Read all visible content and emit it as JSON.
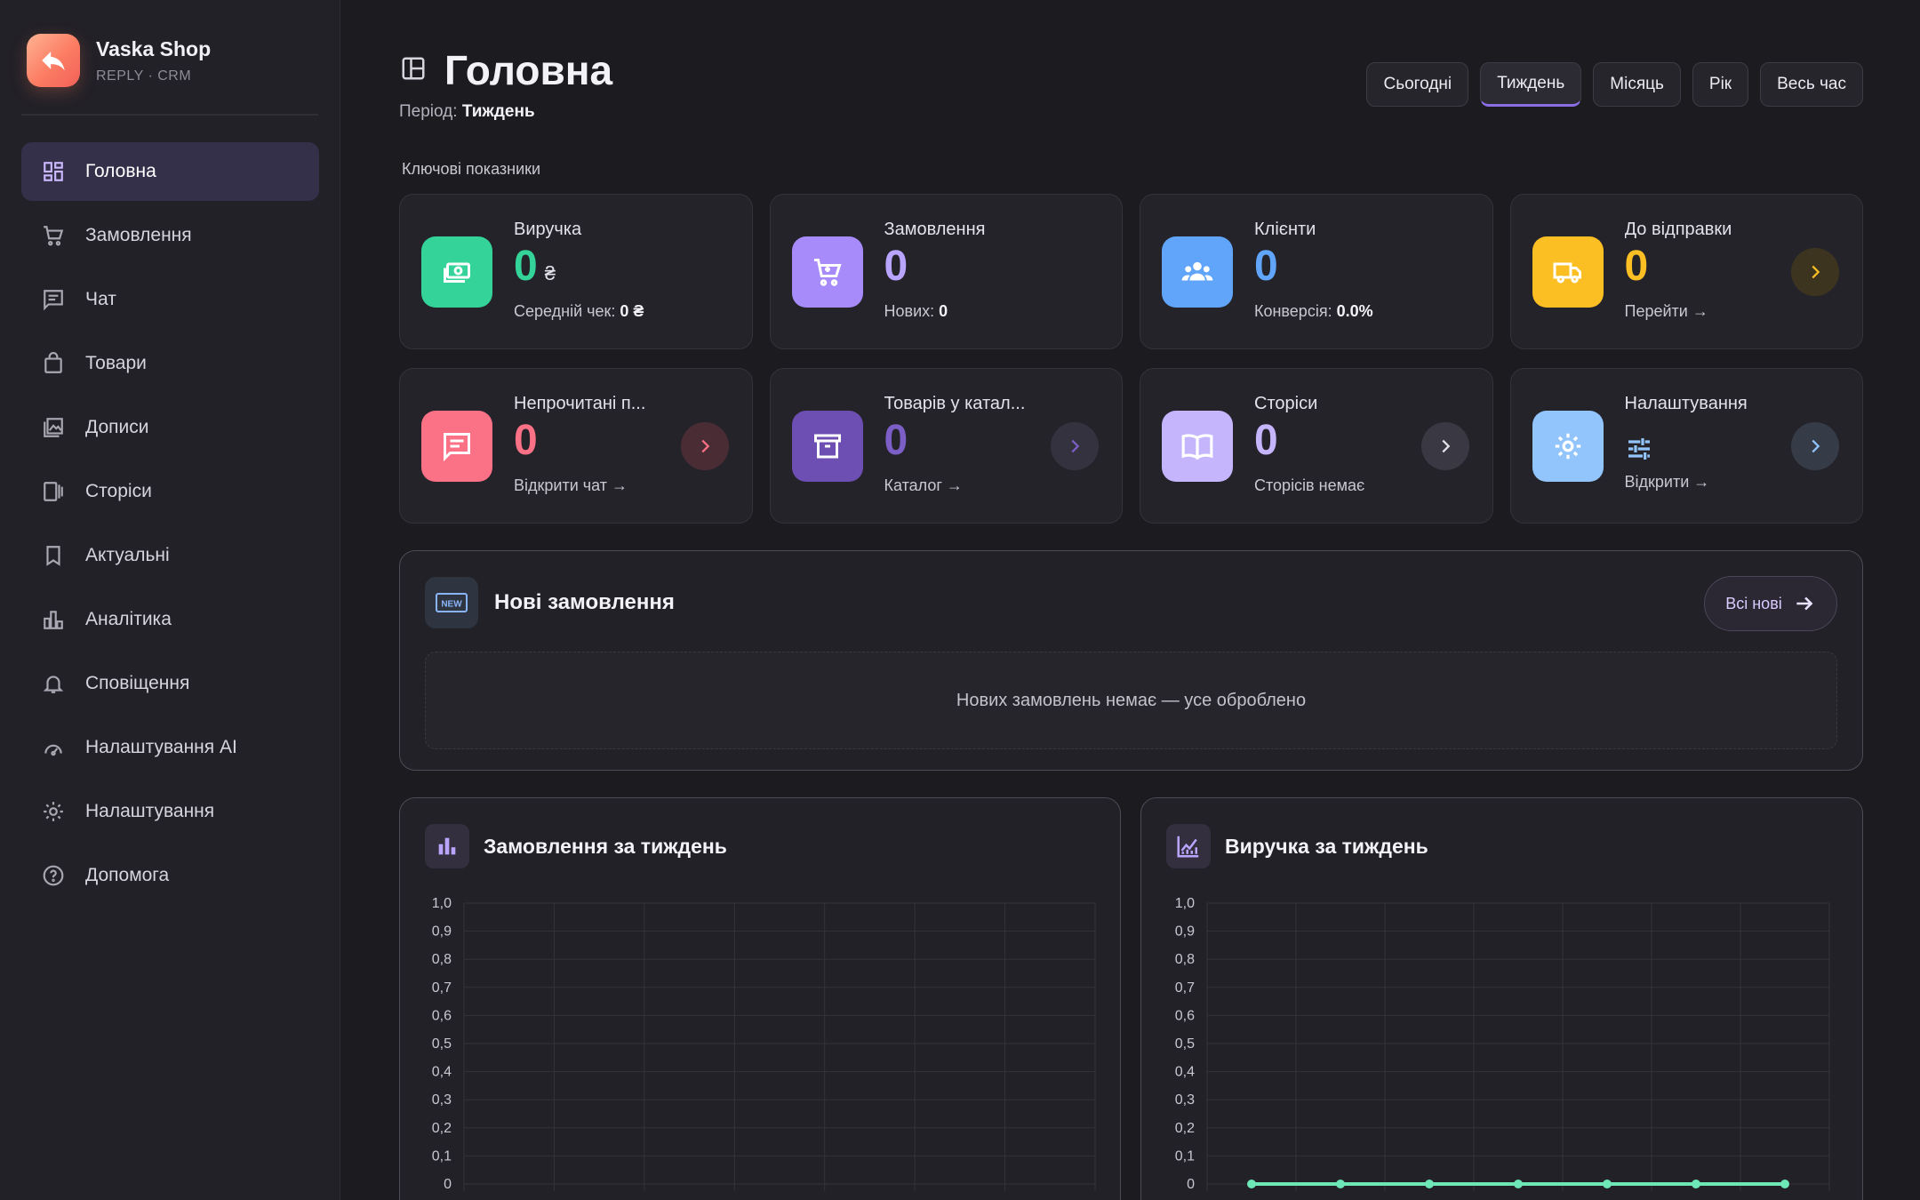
{
  "brand": {
    "name": "Vaska Shop",
    "subtitle": "REPLY · CRM",
    "accent": "#fb7c62"
  },
  "sidebar": {
    "items": [
      {
        "label": "Головна",
        "icon": "dashboard-icon",
        "active": true
      },
      {
        "label": "Замовлення",
        "icon": "cart-icon"
      },
      {
        "label": "Чат",
        "icon": "chat-icon"
      },
      {
        "label": "Товари",
        "icon": "shopping-bag-icon"
      },
      {
        "label": "Дописи",
        "icon": "photo-library-icon"
      },
      {
        "label": "Сторіси",
        "icon": "stories-icon"
      },
      {
        "label": "Актуальні",
        "icon": "bookmark-icon"
      },
      {
        "label": "Аналітика",
        "icon": "analytics-icon"
      },
      {
        "label": "Сповіщення",
        "icon": "bell-icon"
      },
      {
        "label": "Налаштування AI",
        "icon": "ai-settings-icon"
      },
      {
        "label": "Налаштування",
        "icon": "gear-icon"
      },
      {
        "label": "Допомога",
        "icon": "help-icon"
      }
    ]
  },
  "header": {
    "title": "Головна",
    "period_label": "Період:",
    "period_value": "Тиждень",
    "ranges": [
      {
        "label": "Сьогодні"
      },
      {
        "label": "Тиждень",
        "active": true
      },
      {
        "label": "Місяць"
      },
      {
        "label": "Рік"
      },
      {
        "label": "Весь час"
      }
    ]
  },
  "kpi_section_label": "Ключові показники",
  "kpis": [
    {
      "label": "Виручка",
      "value": "0",
      "unit": "₴",
      "sub_label": "Середній чек:",
      "sub_value": "0 ₴",
      "icon": "money-icon",
      "color": "#34d399",
      "value_color": "#34d399"
    },
    {
      "label": "Замовлення",
      "value": "0",
      "sub_label": "Нових:",
      "sub_value": "0",
      "icon": "cart-icon",
      "color": "#a78bfa",
      "value_color": "#b9a4ff"
    },
    {
      "label": "Клієнти",
      "value": "0",
      "sub_label": "Конверсія:",
      "sub_value": "0.0%",
      "icon": "people-icon",
      "color": "#60a5fa",
      "value_color": "#60a5fa"
    },
    {
      "label": "До відправки",
      "value": "0",
      "sub_label": "Перейти →",
      "icon": "truck-icon",
      "color": "#fbbf24",
      "value_color": "#fbbf24",
      "arrow": true
    },
    {
      "label": "Непрочитані п...",
      "value": "0",
      "sub_label": "Відкрити чат →",
      "icon": "chat-icon",
      "color": "#fb7185",
      "value_color": "#fb7185",
      "arrow": true
    },
    {
      "label": "Товарів у катал...",
      "value": "0",
      "sub_label": "Каталог →",
      "icon": "archive-icon",
      "color": "#6d4fb3",
      "value_color": "#7c5fc6",
      "arrow": true
    },
    {
      "label": "Сторіси",
      "value": "0",
      "sub_label": "Сторісів немає",
      "icon": "book-icon",
      "color": "#c4b5fd",
      "value_color": "#c4b5fd",
      "arrow": true
    },
    {
      "label": "Налаштування",
      "value": "",
      "sub_label": "Відкрити →",
      "icon": "gear-icon",
      "color": "#93c5fd",
      "value_color": "#93c5fd",
      "arrow": true,
      "value_icon": "sliders-icon"
    }
  ],
  "new_orders": {
    "badge": "NEW",
    "title": "Нові замовлення",
    "button": "Всі нові",
    "empty_text": "Нових замовлень немає — усе оброблено"
  },
  "charts": {
    "orders": {
      "title": "Замовлення за тиждень",
      "icon": "bar-chart-icon"
    },
    "revenue": {
      "title": "Виручка за тиждень",
      "icon": "line-chart-icon"
    }
  },
  "chart_data": [
    {
      "type": "bar",
      "title": "Замовлення за тиждень",
      "categories": [
        "",
        "",
        "",
        "",
        "",
        "",
        ""
      ],
      "values": [
        0,
        0,
        0,
        0,
        0,
        0,
        0
      ],
      "ylim": [
        0,
        1.0
      ],
      "yticks": [
        "1,0",
        "0,9",
        "0,8",
        "0,7",
        "0,6",
        "0,5",
        "0,4",
        "0,3",
        "0,2",
        "0,1",
        "0"
      ],
      "grid": true
    },
    {
      "type": "line",
      "title": "Виручка за тиждень",
      "categories": [
        "",
        "",
        "",
        "",
        "",
        "",
        ""
      ],
      "values": [
        0,
        0,
        0,
        0,
        0,
        0,
        0
      ],
      "ylim": [
        0,
        1.0
      ],
      "yticks": [
        "1,0",
        "0,9",
        "0,8",
        "0,7",
        "0,6",
        "0,5",
        "0,4",
        "0,3",
        "0,2",
        "0,1",
        "0"
      ],
      "grid": true,
      "color": "#6ee7b7"
    }
  ]
}
